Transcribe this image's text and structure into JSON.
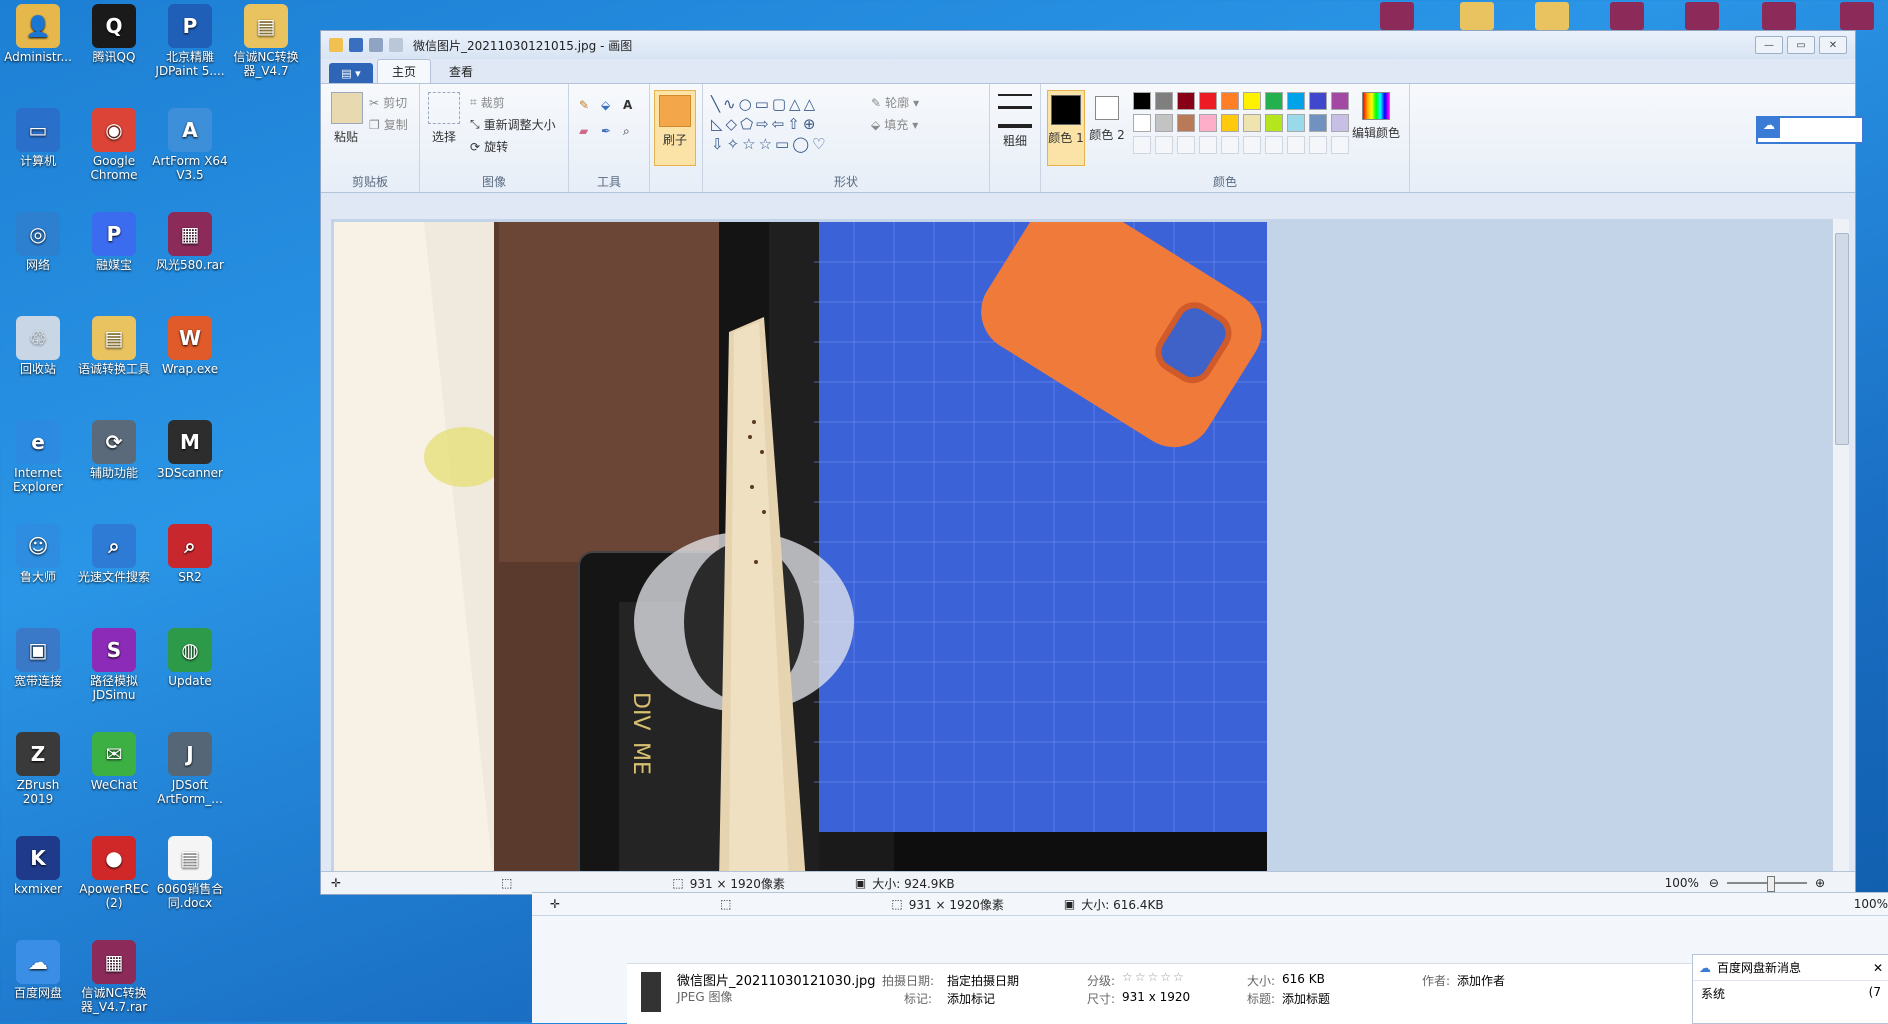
{
  "desktop": {
    "icons": [
      {
        "label": "Administr...",
        "color": "#e6b84c",
        "glyph": "👤"
      },
      {
        "label": "腾讯QQ",
        "color": "#1a1a1a",
        "glyph": "Q"
      },
      {
        "label": "北京精雕 JDPaint 5....",
        "color": "#1f5fb8",
        "glyph": "P"
      },
      {
        "label": "信诚NC转换器_V4.7",
        "color": "#e8c360",
        "glyph": "▤"
      },
      {
        "label": "计算机",
        "color": "#2a6fc9",
        "glyph": "▭"
      },
      {
        "label": "Google Chrome",
        "color": "#db4437",
        "glyph": "◉"
      },
      {
        "label": "ArtForm X64 V3.5",
        "color": "#3c8fd8",
        "glyph": "A"
      },
      {
        "label": "网络",
        "color": "#2d7fd0",
        "glyph": "◎"
      },
      {
        "label": "融媒宝",
        "color": "#3b6cf0",
        "glyph": "P"
      },
      {
        "label": "风光580.rar",
        "color": "#8c2b5a",
        "glyph": "▦"
      },
      {
        "label": "回收站",
        "color": "#c8d6e6",
        "glyph": "♲"
      },
      {
        "label": "语诚转换工具",
        "color": "#e8c360",
        "glyph": "▤"
      },
      {
        "label": "Wrap.exe",
        "color": "#e05a2a",
        "glyph": "W"
      },
      {
        "label": "Internet Explorer",
        "color": "#2c8ae0",
        "glyph": "e"
      },
      {
        "label": "辅助功能",
        "color": "#5a6a7a",
        "glyph": "⟳"
      },
      {
        "label": "3DScanner",
        "color": "#2d2d2d",
        "glyph": "M"
      },
      {
        "label": "鲁大师",
        "color": "#2e8de0",
        "glyph": "☺"
      },
      {
        "label": "光速文件搜索",
        "color": "#2e7bd6",
        "glyph": "⌕"
      },
      {
        "label": "SR2",
        "color": "#c8282d",
        "glyph": "⌕"
      },
      {
        "label": "宽带连接",
        "color": "#3a78c8",
        "glyph": "▣"
      },
      {
        "label": "路径模拟 JDSimu",
        "color": "#8c2bb8",
        "glyph": "S"
      },
      {
        "label": "Update",
        "color": "#2d9a4a",
        "glyph": "◍"
      },
      {
        "label": "ZBrush 2019",
        "color": "#3a3a3a",
        "glyph": "Z"
      },
      {
        "label": "WeChat",
        "color": "#3cb043",
        "glyph": "✉"
      },
      {
        "label": "JDSoft ArtForm_...",
        "color": "#556677",
        "glyph": "J"
      },
      {
        "label": "kxmixer",
        "color": "#1f3a8a",
        "glyph": "K"
      },
      {
        "label": "ApowerREC (2)",
        "color": "#d02828",
        "glyph": "●"
      },
      {
        "label": "6060销售合同.docx",
        "color": "#f5f5f5",
        "glyph": "▤"
      },
      {
        "label": "百度网盘",
        "color": "#3a8ee6",
        "glyph": "☁"
      },
      {
        "label": "信诚NC转换器_V4.7.rar",
        "color": "#8c2b5a",
        "glyph": "▦"
      }
    ]
  },
  "paint": {
    "title": "微信图片_20211030121015.jpg - 画图",
    "file_menu_label": "▤ ▾",
    "tabs": [
      "主页",
      "查看"
    ],
    "clipboard": {
      "paste": "粘贴",
      "cut": "剪切",
      "copy": "复制",
      "group": "剪贴板"
    },
    "image": {
      "select": "选择",
      "crop": "裁剪",
      "resize": "重新调整大小",
      "rotate": "旋转",
      "group": "图像"
    },
    "tools": {
      "group": "工具"
    },
    "brushes": {
      "label": "刷子"
    },
    "shapes": {
      "outline": "轮廓",
      "fill": "填充",
      "group": "形状"
    },
    "size": {
      "label": "粗细"
    },
    "colors": {
      "color1": "颜色 1",
      "color2": "颜色 2",
      "edit": "编辑颜色",
      "group": "颜色",
      "palette_row1": [
        "#000000",
        "#7f7f7f",
        "#880015",
        "#ed1c24",
        "#ff7f27",
        "#fff200",
        "#22b14c",
        "#00a2e8",
        "#3f48cc",
        "#a349a4"
      ],
      "palette_row2": [
        "#ffffff",
        "#c3c3c3",
        "#b97a57",
        "#ffaec9",
        "#ffc90e",
        "#efe4b0",
        "#b5e61d",
        "#99d9ea",
        "#7092be",
        "#c8bfe7"
      ]
    },
    "status": {
      "dimensions": "931 × 1920像素",
      "filesize": "大小: 924.9KB",
      "zoom": "100%"
    }
  },
  "viewer": {
    "status_dimensions": "931 × 1920像素",
    "status_size": "大小: 616.4KB",
    "zoom": "100%",
    "details": {
      "filename": "微信图片_20211030121030.jpg",
      "filetype": "JPEG 图像",
      "date_label": "拍摄日期:",
      "date_value": "指定拍摄日期",
      "tags_label": "标记:",
      "tags_value": "添加标记",
      "rating_label": "分级:",
      "rating_stars": "☆☆☆☆☆",
      "size_label": "大小:",
      "size_value": "616 KB",
      "dims_label": "尺寸:",
      "dims_value": "931 x 1920",
      "author_label": "作者:",
      "author_value": "添加作者",
      "title_label": "标题:",
      "title_value": "添加标题"
    }
  },
  "notification": {
    "title": "百度网盘新消息",
    "body": "系统",
    "count": "(7"
  }
}
